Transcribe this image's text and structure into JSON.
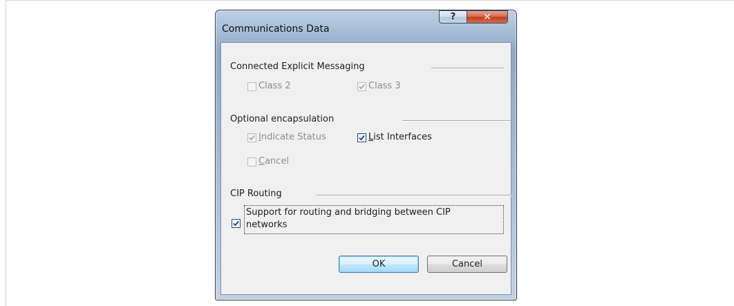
{
  "window": {
    "title": "Communications Data",
    "help_glyph": "?",
    "close_glyph": "✕"
  },
  "explicit_messaging": {
    "heading": "Connected Explicit Messaging",
    "class2": {
      "label": "Class 2",
      "checked": false,
      "enabled": false
    },
    "class3": {
      "label": "Class 3",
      "checked": true,
      "enabled": false
    }
  },
  "encapsulation": {
    "heading": "Optional encapsulation",
    "indicate_status": {
      "label_first": "I",
      "label_rest": "ndicate Status",
      "checked": true,
      "enabled": false
    },
    "list_interfaces": {
      "label_first": "L",
      "label_rest": "ist Interfaces",
      "checked": true,
      "enabled": true
    },
    "cancel": {
      "label_first": "C",
      "label_rest": "ancel",
      "checked": false,
      "enabled": false
    }
  },
  "cip_routing": {
    "heading": "CIP Routing",
    "support_line1": "Support for routing and bridging between CIP",
    "support_line2": "networks",
    "checked": true
  },
  "buttons": {
    "ok": "OK",
    "cancel": "Cancel"
  },
  "colors": {
    "caption": "#a6bcd6",
    "close": "#c23d1e",
    "client": "#f0f0f0",
    "check": "#1c3f7a"
  }
}
